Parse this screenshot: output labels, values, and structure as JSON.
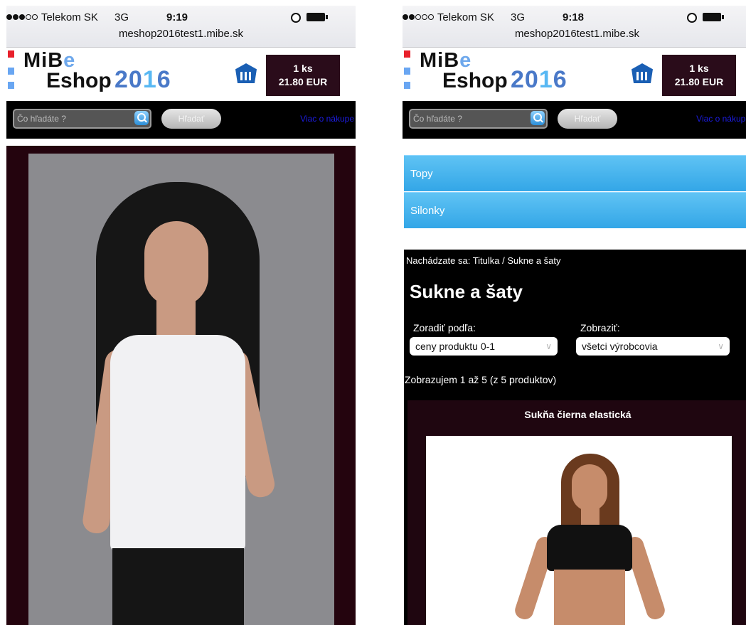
{
  "left": {
    "status": {
      "carrier": "Telekom SK",
      "network": "3G",
      "time": "9:19",
      "url": "meshop2016test1.mibe.sk"
    },
    "header": {
      "logo_mibe": "MiB",
      "logo_e": "e",
      "logo_eshop": "Eshop",
      "logo_year_a": "20",
      "logo_year_b": "1",
      "logo_year_c": "6"
    },
    "cart": {
      "count": "1 ks",
      "total": "21.80 EUR"
    },
    "search": {
      "placeholder": "Čo hľadáte ?",
      "button": "Hľadať",
      "more_link": "Viac o nákupe"
    }
  },
  "right": {
    "status": {
      "carrier": "Telekom SK",
      "network": "3G",
      "time": "9:18",
      "url": "meshop2016test1.mibe.sk"
    },
    "header": {
      "logo_mibe": "MiB",
      "logo_e": "e",
      "logo_eshop": "Eshop",
      "logo_year_a": "20",
      "logo_year_b": "1",
      "logo_year_c": "6"
    },
    "cart": {
      "count": "1 ks",
      "total": "21.80 EUR"
    },
    "search": {
      "placeholder": "Čo hľadáte ?",
      "button": "Hľadať",
      "more_link": "Viac o nákupe"
    },
    "categories": [
      {
        "label": "Topy"
      },
      {
        "label": "Silonky"
      }
    ],
    "listing": {
      "breadcrumb": "Nachádzate sa: Titulka / Sukne a šaty",
      "title": "Sukne a šaty",
      "sort_label": "Zoradiť podľa:",
      "sort_value": "ceny produktu 0-1",
      "show_label": "Zobraziť:",
      "show_value": "všetci výrobcovia",
      "count_text": "Zobrazujem 1 až 5 (z 5 produktov)",
      "product_name": "Sukňa čierna elastická"
    }
  },
  "colors": {
    "brand_dark": "#2a0c1a",
    "category_blue": "#3fb1ec",
    "link_blue": "#1c1ce0",
    "logo_red": "#e8202b"
  }
}
